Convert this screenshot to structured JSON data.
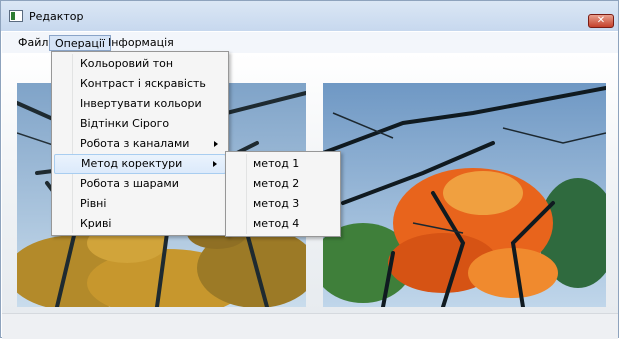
{
  "window": {
    "title": "Редактор",
    "close_glyph": "✕"
  },
  "menubar": {
    "items": [
      {
        "label": "Файл"
      },
      {
        "label": "Операції"
      },
      {
        "label": "Інформація"
      }
    ]
  },
  "operations_menu": {
    "items": [
      {
        "label": "Кольоровий тон"
      },
      {
        "label": "Контраст і яскравість"
      },
      {
        "label": "Інвертувати кольори"
      },
      {
        "label": "Відтінки Сірого"
      },
      {
        "label": "Робота з каналами"
      },
      {
        "label": "Метод коректури"
      },
      {
        "label": "Робота з шарами"
      },
      {
        "label": "Рівні"
      },
      {
        "label": "Криві"
      }
    ]
  },
  "correction_submenu": {
    "items": [
      {
        "label": "метод 1"
      },
      {
        "label": "метод 2"
      },
      {
        "label": "метод 3"
      },
      {
        "label": "метод 4"
      }
    ]
  },
  "icons": {
    "app": "app-window-icon",
    "close": "close-icon",
    "submenu_arrow": "chevron-right-icon"
  },
  "colors": {
    "titlebar": "#c7d8ee",
    "close_button": "#c4402b",
    "menu_highlight": "#dceafb",
    "foliage_orange": "#e8641c",
    "sky_blue": "#9fbfe0"
  }
}
